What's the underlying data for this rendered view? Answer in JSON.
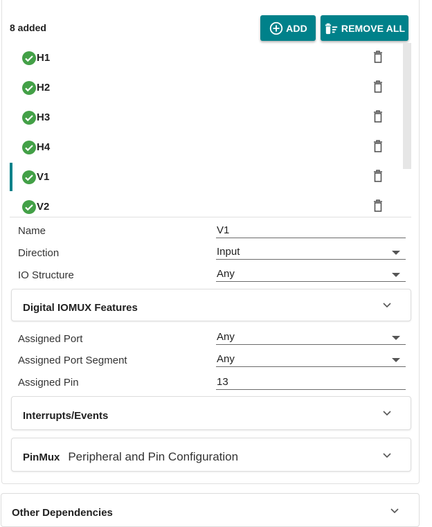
{
  "header": {
    "count_label": "8 added"
  },
  "toolbar": {
    "add_label": "ADD",
    "remove_all_label": "REMOVE ALL"
  },
  "pins": [
    {
      "name": "H1",
      "status": "ok",
      "selected": false
    },
    {
      "name": "H2",
      "status": "ok",
      "selected": false
    },
    {
      "name": "H3",
      "status": "ok",
      "selected": false
    },
    {
      "name": "H4",
      "status": "ok",
      "selected": false
    },
    {
      "name": "V1",
      "status": "ok",
      "selected": true
    },
    {
      "name": "V2",
      "status": "ok",
      "selected": false
    }
  ],
  "properties": {
    "name": {
      "label": "Name",
      "value": "V1"
    },
    "direction": {
      "label": "Direction",
      "value": "Input"
    },
    "io_structure": {
      "label": "IO Structure",
      "value": "Any"
    },
    "assigned_port": {
      "label": "Assigned Port",
      "value": "Any"
    },
    "assigned_port_segment": {
      "label": "Assigned Port Segment",
      "value": "Any"
    },
    "assigned_pin": {
      "label": "Assigned Pin",
      "value": "13"
    }
  },
  "sections": {
    "digital_iomux": {
      "title": "Digital IOMUX Features"
    },
    "interrupts": {
      "title": "Interrupts/Events"
    },
    "pinmux": {
      "title": "PinMux",
      "subtitle": "Peripheral and Pin Configuration"
    },
    "other_dependencies": {
      "title": "Other Dependencies"
    }
  },
  "colors": {
    "accent": "#00818a",
    "check": "#43a047",
    "border": "#dcdcdc"
  },
  "icons": {
    "add": "plus-circle-icon",
    "remove_all": "delete-sweep-icon",
    "row_status": "check-circle-icon",
    "row_delete": "trash-icon",
    "expand": "chevron-down-icon"
  }
}
